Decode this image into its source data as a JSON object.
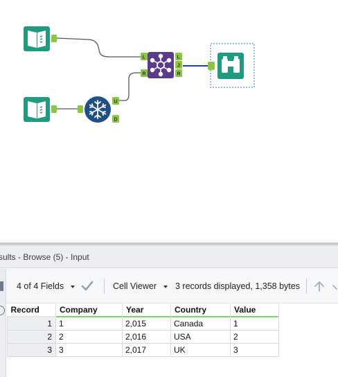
{
  "colors": {
    "input_tool": "#1f9c80",
    "browse_tool": "#1f9c80",
    "join_tool": "#5b3c8c",
    "generate_tool": "#1e4f86",
    "anchor": "#8cc63f",
    "connection": "#555555",
    "selected_connection": "#1f3fbf",
    "selection_dash": "#2b6ccf"
  },
  "workflow": {
    "join_anchors_in": [
      "L",
      "R"
    ],
    "join_anchors_out": [
      "L",
      "J",
      "R"
    ],
    "generate_anchors_out": [
      "U",
      "D"
    ],
    "icons": {
      "input_1": "book-icon",
      "input_2": "book-icon",
      "join": "join-network-icon",
      "generate": "snowflake-icon",
      "browse": "binoculars-icon"
    }
  },
  "results": {
    "title": "sults - Browse (5) - Input",
    "fields_selector": "4 of 4 Fields",
    "cell_viewer": "Cell Viewer",
    "record_status": "3 records displayed, 1,358 bytes",
    "columns": [
      "Record",
      "Company",
      "Year",
      "Country",
      "Value"
    ],
    "rows": [
      [
        "1",
        "1",
        "2,015",
        "Canada",
        "1"
      ],
      [
        "2",
        "2",
        "2,016",
        "USA",
        "2"
      ],
      [
        "3",
        "3",
        "2,017",
        "UK",
        "3"
      ]
    ]
  }
}
